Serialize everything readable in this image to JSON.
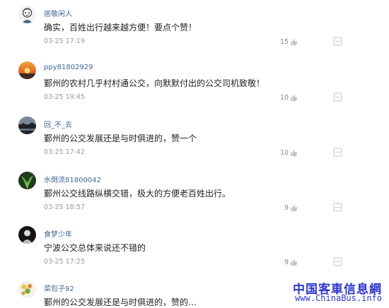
{
  "comments": [
    {
      "username": "居敬闲人",
      "content": "确实，百姓出行越来越方便！要点个赞！",
      "time": "03-25 17:19",
      "likes": "15",
      "avatar": "cartoon-face-avatar"
    },
    {
      "username": "ppy81802929",
      "content": "鄞州的农村几乎村村通公交，向默默付出的公交司机致敬！",
      "time": "03-25 19:45",
      "likes": "10",
      "avatar": "sunset-avatar"
    },
    {
      "username": "回_不_去",
      "content": "鄞州的公交发展还是与时俱进的，赞一个",
      "time": "03-25 17:42",
      "likes": "10",
      "avatar": "landscape-avatar"
    },
    {
      "username": "水倒流81800042",
      "content": "鄞州公交线路纵横交错，极大的方便老百姓出行。",
      "time": "03-25 18:57",
      "likes": "9",
      "avatar": "green-plant-avatar"
    },
    {
      "username": "食梦少年",
      "content": "宁波公交总体来说还不错的",
      "time": "03-25 17:25",
      "likes": "9",
      "avatar": "dark-figure-avatar"
    },
    {
      "username": "菜包子92",
      "content": "鄞州的公交发展还是与时俱进的，赞的…",
      "time": "",
      "likes": "",
      "avatar": "flower-avatar"
    }
  ],
  "icons": {
    "like": "thumbs-up-icon",
    "menu": "more-icon"
  },
  "colors": {
    "username": "#406599",
    "text": "#222222",
    "meta": "#9a9a9a",
    "watermark": "#2f37c9"
  },
  "watermark": {
    "chinese": "中国客車信息網",
    "url": "www.ChinaBus.info"
  }
}
